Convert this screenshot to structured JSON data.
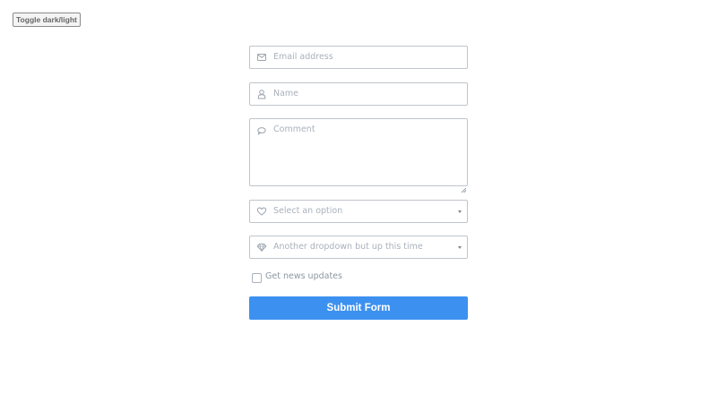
{
  "toggle": {
    "label": "Toggle dark/light"
  },
  "form": {
    "email": {
      "placeholder": "Email address",
      "icon": "envelope-icon"
    },
    "name": {
      "placeholder": "Name",
      "icon": "user-icon"
    },
    "comment": {
      "placeholder": "Comment",
      "icon": "speech-bubble-icon"
    },
    "select1": {
      "placeholder": "Select an option",
      "icon": "heart-icon"
    },
    "select2": {
      "placeholder": "Another dropdown but up this time",
      "icon": "gem-icon"
    },
    "newsletter": {
      "label": "Get news updates",
      "checked": false
    },
    "submit": {
      "label": "Submit Form"
    }
  },
  "colors": {
    "accent": "#3c91f0",
    "border": "#bfc5cc",
    "placeholder": "#a9b1bc"
  }
}
